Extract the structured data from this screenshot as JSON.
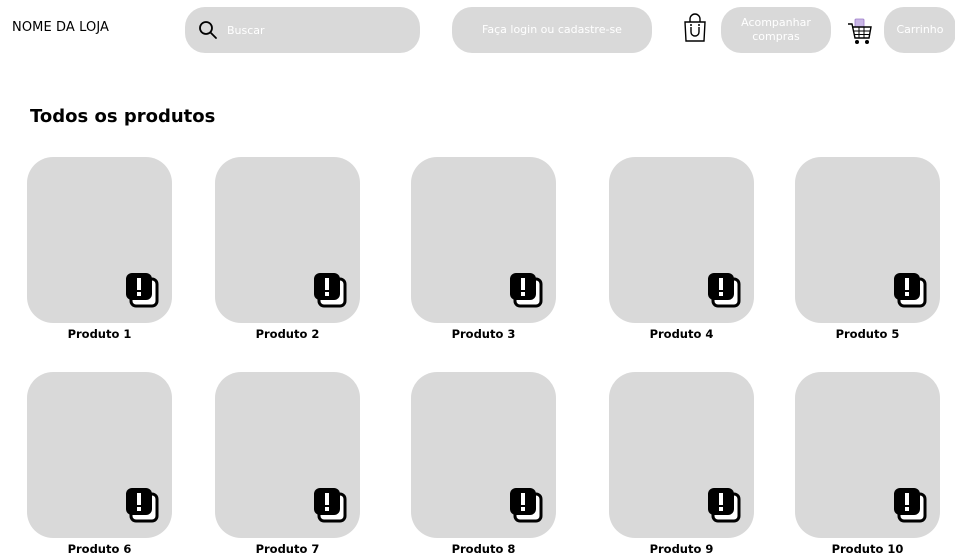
{
  "header": {
    "store_name": "NOME DA LOJA",
    "search_placeholder": "Buscar",
    "login_label": "Faça login ou cadastre-se",
    "track_label": "Acompanhar compras",
    "cart_label": "Carrinho",
    "icons": {
      "search": "search-icon",
      "bag": "shopping-bag-icon",
      "cart": "shopping-cart-icon"
    }
  },
  "main": {
    "title": "Todos os produtos",
    "products": [
      {
        "name": "Produto 1"
      },
      {
        "name": "Produto 2"
      },
      {
        "name": "Produto 3"
      },
      {
        "name": "Produto 4"
      },
      {
        "name": "Produto 5"
      },
      {
        "name": "Produto 6"
      },
      {
        "name": "Produto 7"
      },
      {
        "name": "Produto 8"
      },
      {
        "name": "Produto 9"
      },
      {
        "name": "Produto 10"
      }
    ],
    "product_badge_icon": "alert-stack-icon"
  },
  "colors": {
    "placeholder_fill": "#d9d9d9",
    "button_text": "#ffffff",
    "text": "#000000"
  }
}
